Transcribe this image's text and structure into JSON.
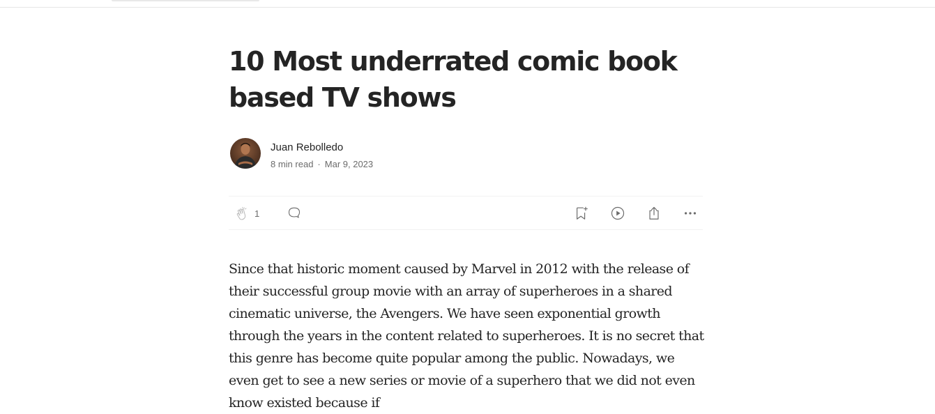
{
  "article": {
    "title": "10 Most underrated comic book based TV shows",
    "author": {
      "name": "Juan Rebolledo",
      "avatar": "author-avatar-photo"
    },
    "read_time": "8 min read",
    "separator": "·",
    "date": "Mar 9, 2023",
    "actions": {
      "clap_count": "1",
      "icons": [
        "clap-icon",
        "comment-icon",
        "bookmark-add-icon",
        "play-icon",
        "share-icon",
        "more-icon"
      ]
    },
    "body": "Since that historic moment caused by Marvel in 2012 with the release of their successful group movie with an array of superheroes in a shared cinematic universe, the Avengers. We have seen exponential growth through the years in the content related to superheroes. It is no secret that this genre has become quite popular among the public. Nowadays, we even get to see a new series or movie of a superhero that we did not even know existed because if"
  },
  "colors": {
    "text": "#242424",
    "muted": "#6b6b6b",
    "divider": "#f2f2f2"
  }
}
